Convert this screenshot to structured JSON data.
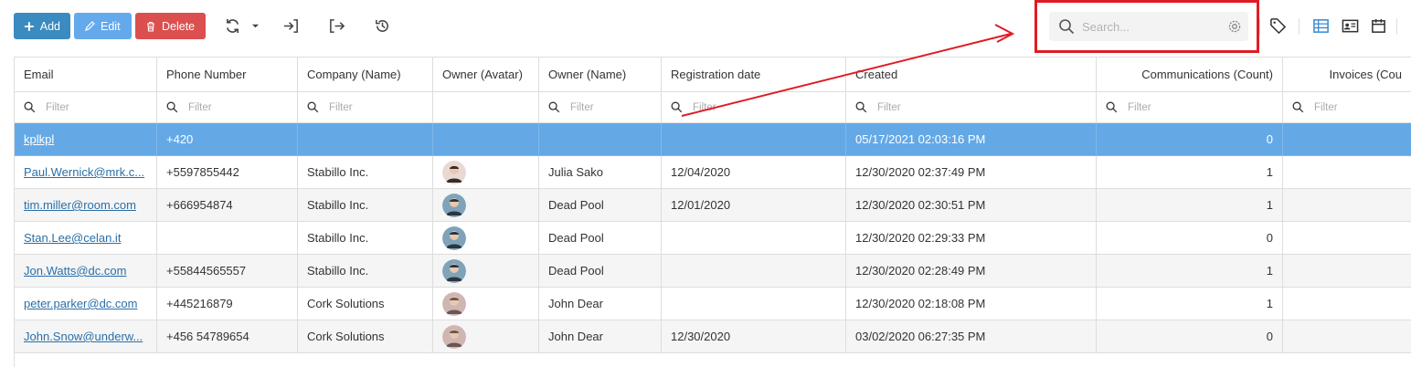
{
  "toolbar": {
    "add_label": "Add",
    "edit_label": "Edit",
    "delete_label": "Delete",
    "search_placeholder": "Search...",
    "colors": {
      "add": "#3a8bbf",
      "edit": "#64a9ec",
      "delete": "#dc4f4f",
      "highlight": "#e01b24"
    }
  },
  "grid": {
    "headers": [
      "Email",
      "Phone Number",
      "Company (Name)",
      "Owner (Avatar)",
      "Owner (Name)",
      "Registration date",
      "Created",
      "Communications (Count)",
      "Invoices (Cou"
    ],
    "filter_placeholder": "Filter",
    "rows": [
      {
        "email": "kplkpl",
        "phone": "+420",
        "company": "",
        "avatar": "",
        "owner": "",
        "registration": "",
        "created": "05/17/2021 02:03:16 PM",
        "communications": "0",
        "invoices": ""
      },
      {
        "email": "Paul.Wernick@mrk.c...",
        "phone": "+5597855442",
        "company": "Stabillo Inc.",
        "avatar": "woman",
        "owner": "Julia Sako",
        "registration": "12/04/2020",
        "created": "12/30/2020 02:37:49 PM",
        "communications": "1",
        "invoices": ""
      },
      {
        "email": "tim.miller@room.com",
        "phone": "+666954874",
        "company": "Stabillo Inc.",
        "avatar": "man",
        "owner": "Dead Pool",
        "registration": "12/01/2020",
        "created": "12/30/2020 02:30:51 PM",
        "communications": "1",
        "invoices": ""
      },
      {
        "email": "Stan.Lee@celan.it",
        "phone": "",
        "company": "Stabillo Inc.",
        "avatar": "man",
        "owner": "Dead Pool",
        "registration": "",
        "created": "12/30/2020 02:29:33 PM",
        "communications": "0",
        "invoices": ""
      },
      {
        "email": "Jon.Watts@dc.com",
        "phone": "+55844565557",
        "company": "Stabillo Inc.",
        "avatar": "man",
        "owner": "Dead Pool",
        "registration": "",
        "created": "12/30/2020 02:28:49 PM",
        "communications": "1",
        "invoices": ""
      },
      {
        "email": "peter.parker@dc.com",
        "phone": "+445216879",
        "company": "Cork Solutions",
        "avatar": "older-man",
        "owner": "John Dear",
        "registration": "",
        "created": "12/30/2020 02:18:08 PM",
        "communications": "1",
        "invoices": ""
      },
      {
        "email": "John.Snow@underw...",
        "phone": "+456 54789654",
        "company": "Cork Solutions",
        "avatar": "older-man",
        "owner": "John Dear",
        "registration": "12/30/2020",
        "created": "03/02/2020 06:27:35 PM",
        "communications": "0",
        "invoices": ""
      }
    ]
  }
}
